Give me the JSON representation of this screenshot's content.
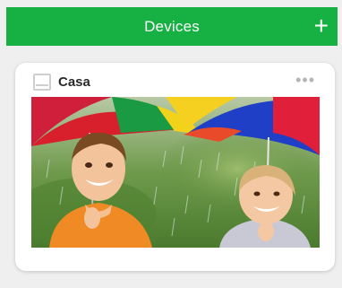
{
  "header": {
    "title": "Devices",
    "add_label": "+"
  },
  "device_card": {
    "name": "Casa",
    "more_label": "•••",
    "camera_icon": "camera-icon",
    "more_icon": "more-icon"
  },
  "colors": {
    "header_bg": "#17b042",
    "page_bg": "#efefef",
    "card_bg": "#ffffff"
  }
}
